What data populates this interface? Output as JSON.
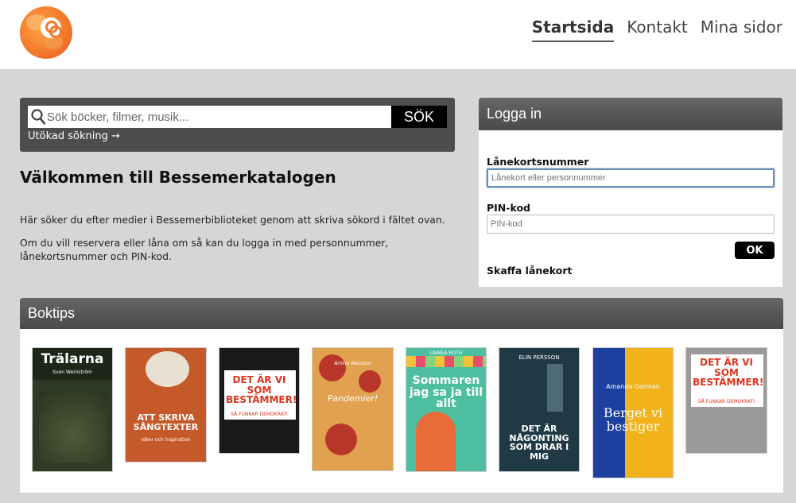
{
  "header": {
    "nav": [
      {
        "label": "Startsida",
        "active": true
      },
      {
        "label": "Kontakt",
        "active": false
      },
      {
        "label": "Mina sidor",
        "active": false
      }
    ]
  },
  "search": {
    "placeholder": "Sök böcker, filmer, musik...",
    "button_label": "SÖK",
    "advanced_link": "Utökad sökning →"
  },
  "welcome": {
    "title": "Välkommen till Bessemerkatalogen",
    "paragraph1": "Här söker du efter medier i Bessemerbiblioteket genom att skriva sökord i fältet ovan.",
    "paragraph2": "Om du vill reservera eller låna om så kan du logga in med personnummer, lånekortsnummer och PIN-kod."
  },
  "login": {
    "title": "Logga in",
    "card_label": "Lånekortsnummer",
    "card_placeholder": "Lånekort eller personnummer",
    "pin_label": "PIN-kod",
    "pin_placeholder": "PIN-kod",
    "ok_label": "OK",
    "get_card_link": "Skaffa lånekort"
  },
  "boktips": {
    "title": "Boktips",
    "books": [
      {
        "title": "Trälarna",
        "subtitle": "Sven Wernström",
        "bg": "#2e3a25",
        "fg": "#ffffff"
      },
      {
        "title": "ATT SKRIVA SÅNGTEXTER",
        "subtitle": "idéer och inspiration",
        "bg": "#c45a2a",
        "fg": "#ffffff"
      },
      {
        "title": "DET ÄR VI SOM BESTÄMMER!",
        "subtitle": "SÅ FUNKAR DEMOKRATI",
        "bg": "#1a1a1a",
        "fg": "#ffffff"
      },
      {
        "title": "Pandemier!",
        "subtitle": "Amina Manzoor",
        "bg": "#e2a14f",
        "fg": "#ffffff"
      },
      {
        "title": "Sommaren jag sa ja till allt",
        "subtitle": "LINNEA ROTH",
        "bg": "#4dbfa0",
        "fg": "#ffffff"
      },
      {
        "title": "DET ÄR NÅGONTING SOM DRAR I MIG",
        "subtitle": "ELIN PERSSON",
        "bg": "#1f3a45",
        "fg": "#ffffff"
      },
      {
        "title": "Berget vi bestiger",
        "subtitle": "Amanda Gorman",
        "bg": "#1c3fa0",
        "fg": "#ffffff"
      },
      {
        "title": "DET ÄR VI SOM BESTÄMMER!",
        "subtitle": "SÅ FUNKAR DEMOKRATI",
        "bg": "#9a9a9a",
        "fg": "#ffffff"
      }
    ]
  }
}
